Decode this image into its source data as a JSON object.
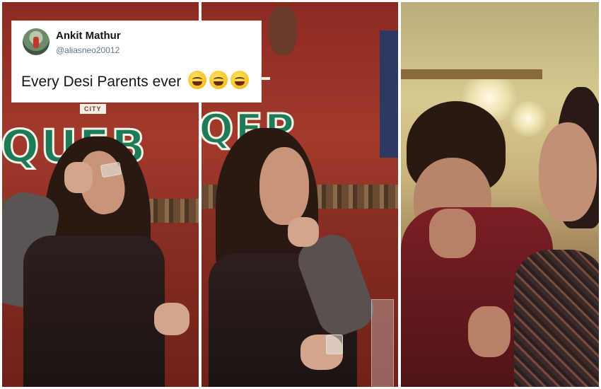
{
  "tweet": {
    "name": "Ankit Mathur",
    "handle": "@aliasneo20012",
    "text": "Every Desi Parents ever",
    "emojis": [
      "rolling-on-floor-laughing-icon",
      "rolling-on-floor-laughing-icon",
      "rolling-on-floor-laughing-icon"
    ]
  },
  "panels": [
    {
      "scene": "restaurant-woman-drinking-shot",
      "sign_text": "QUEB",
      "strip_text": "CITY"
    },
    {
      "scene": "restaurant-woman-eating-lime",
      "sign_text": "QEP"
    },
    {
      "scene": "couple-reacting"
    }
  ],
  "colors": {
    "sign_green": "#1d7c57",
    "wall_red": "#a23a2c",
    "maroon": "#7a1f24"
  }
}
